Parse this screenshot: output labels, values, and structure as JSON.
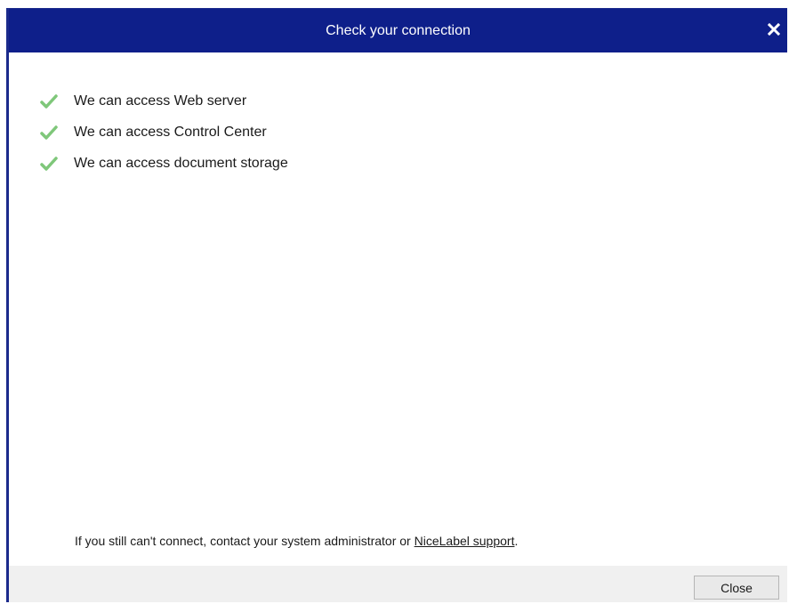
{
  "dialog": {
    "title": "Check your connection",
    "close_icon": "close-icon"
  },
  "checks": [
    {
      "label": "We can access Web server",
      "icon": "checkmark-icon",
      "color": "#7fc77a"
    },
    {
      "label": "We can access Control Center",
      "icon": "checkmark-icon",
      "color": "#7fc77a"
    },
    {
      "label": "We can access document storage",
      "icon": "checkmark-icon",
      "color": "#7fc77a"
    }
  ],
  "footer": {
    "text_before_link": "If you still can't connect, contact your system administrator or ",
    "link_text": "NiceLabel support",
    "text_after_link": "."
  },
  "buttons": {
    "close_label": "Close"
  },
  "colors": {
    "titlebar": "#0e1f8a",
    "check": "#7fc77a",
    "button_bar": "#f0f0f0"
  }
}
